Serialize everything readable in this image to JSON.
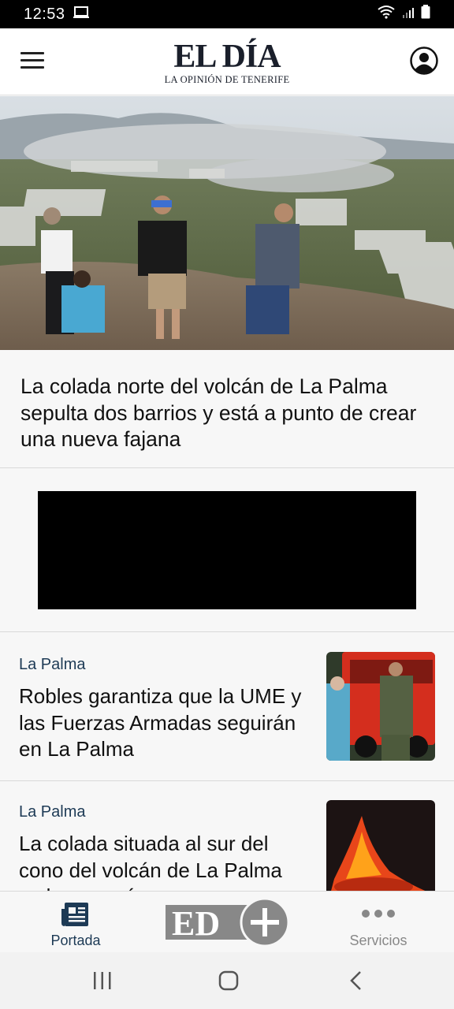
{
  "status_bar": {
    "time": "12:53"
  },
  "header": {
    "logo_main": "EL DÍA",
    "logo_sub": "LA OPINIÓN DE TENERIFE"
  },
  "hero": {
    "headline": "La colada norte del volcán de La Palma sepulta dos barrios y está a punto de crear una nueva fajana"
  },
  "articles": [
    {
      "section": "La Palma",
      "headline": "Robles garantiza que la UME y las Fuerzas Armadas seguirán en La Palma"
    },
    {
      "section": "La Palma",
      "headline": "La colada situada al sur del cono del volcán de La Palma es la que más"
    }
  ],
  "bottom_nav": {
    "home_label": "Portada",
    "services_label": "Servicios",
    "active_color": "#1d3a55",
    "inactive_color": "#888888"
  },
  "colors": {
    "brand": "#1a1f2b",
    "section": "#1d3a55"
  }
}
